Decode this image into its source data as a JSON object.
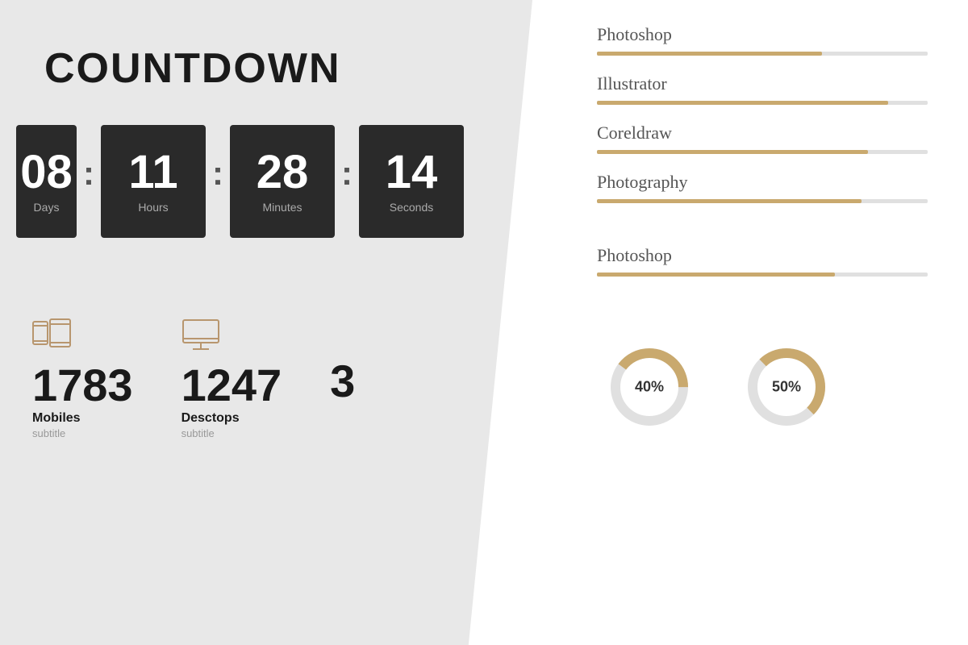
{
  "left": {
    "title": "COUNTDOWN",
    "timer": {
      "days": {
        "value": "08",
        "label": "Days"
      },
      "hours": {
        "value": "11",
        "label": "Hours"
      },
      "minutes": {
        "value": "28",
        "label": "Minutes"
      },
      "seconds": {
        "value": "14",
        "label": "Seconds"
      }
    },
    "stats": [
      {
        "id": "mobiles",
        "number": "1783",
        "title": "Mobiles",
        "subtitle": "subtitle",
        "icon": "mobile"
      },
      {
        "id": "desktops",
        "number": "1247",
        "title": "Desctops",
        "subtitle": "subtitle",
        "icon": "desktop"
      },
      {
        "id": "third",
        "number": "3",
        "title": "",
        "subtitle": "",
        "icon": "none"
      }
    ]
  },
  "right": {
    "skills": [
      {
        "name": "Photoshop",
        "percent": 68
      },
      {
        "name": "Illustrator",
        "percent": 88
      },
      {
        "name": "Coreldraw",
        "percent": 82
      },
      {
        "name": "Photography",
        "percent": 80
      }
    ],
    "skills2": [
      {
        "name": "Photoshop",
        "percent": 72
      }
    ],
    "donuts": [
      {
        "label": "40%",
        "percent": 40
      },
      {
        "label": "50%",
        "percent": 50
      }
    ]
  }
}
